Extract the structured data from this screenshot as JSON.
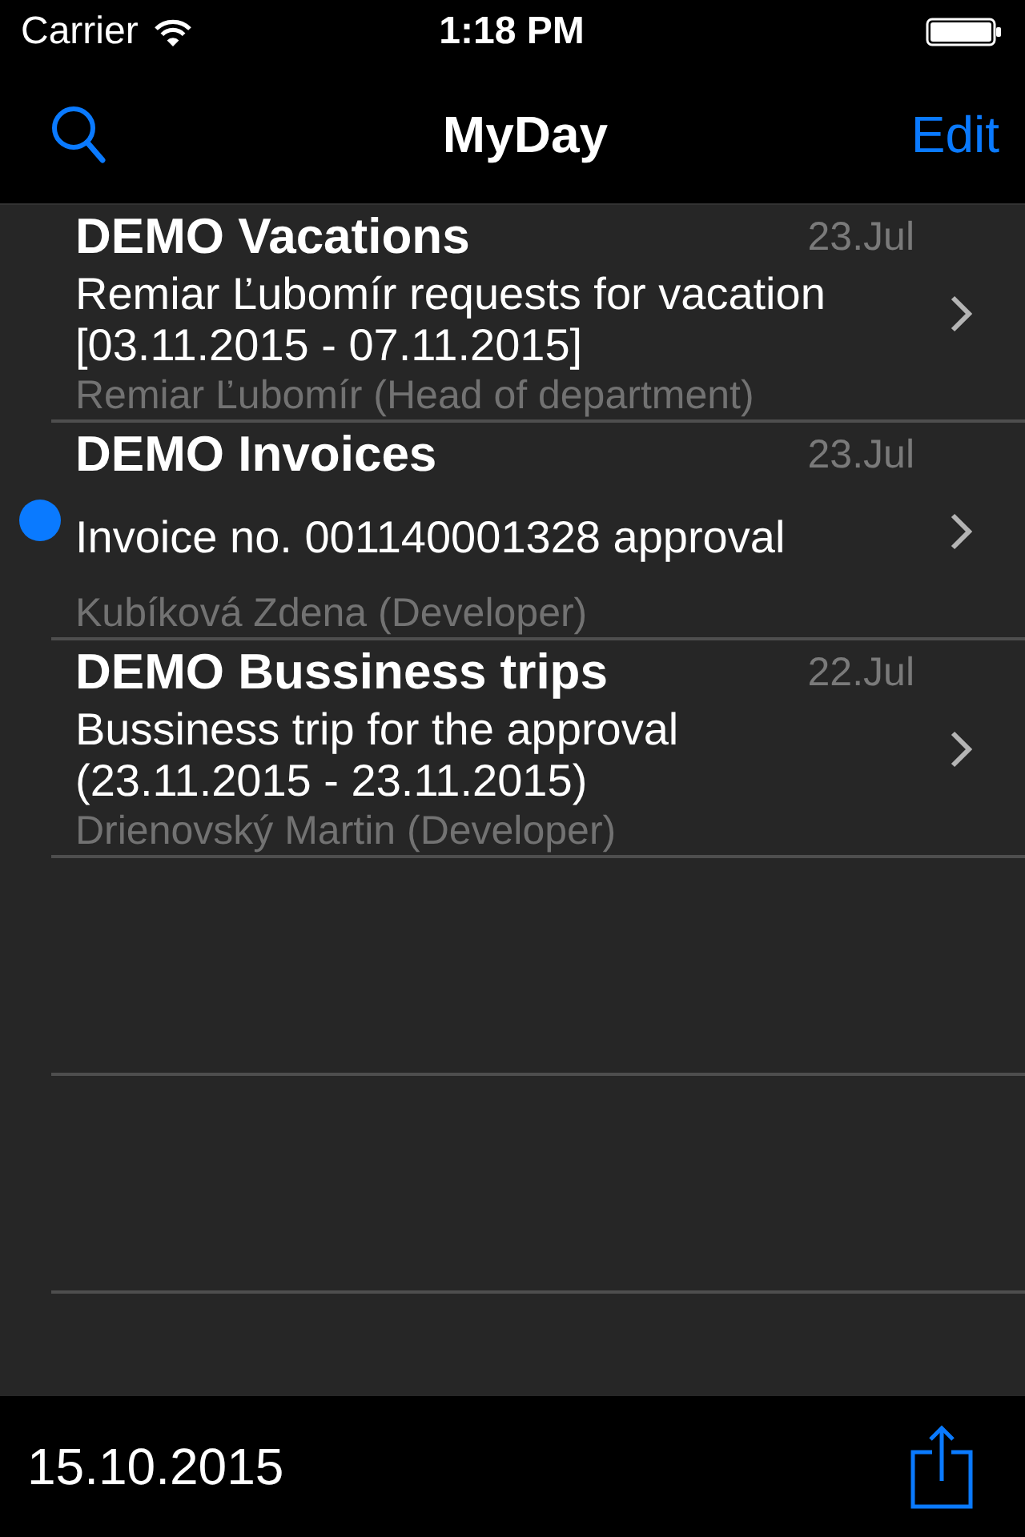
{
  "status_bar": {
    "carrier": "Carrier",
    "time": "1:18 PM"
  },
  "nav_bar": {
    "title": "MyDay",
    "edit_button": "Edit"
  },
  "items": [
    {
      "category": "DEMO Vacations",
      "date": "23.Jul",
      "subject": "Remiar Ľubomír requests for vacation [03.11.2015 - 07.11.2015]",
      "author": "Remiar Ľubomír (Head of department)",
      "unread": false
    },
    {
      "category": "DEMO Invoices",
      "date": "23.Jul",
      "subject": "Invoice no. 001140001328 approval",
      "author": "Kubíková Zdena (Developer)",
      "unread": true
    },
    {
      "category": "DEMO Bussiness trips",
      "date": "22.Jul",
      "subject": "Bussiness trip for the approval (23.11.2015 - 23.11.2015)",
      "author": "Drienovský Martin (Developer)",
      "unread": false
    }
  ],
  "toolbar": {
    "date": "15.10.2015"
  }
}
